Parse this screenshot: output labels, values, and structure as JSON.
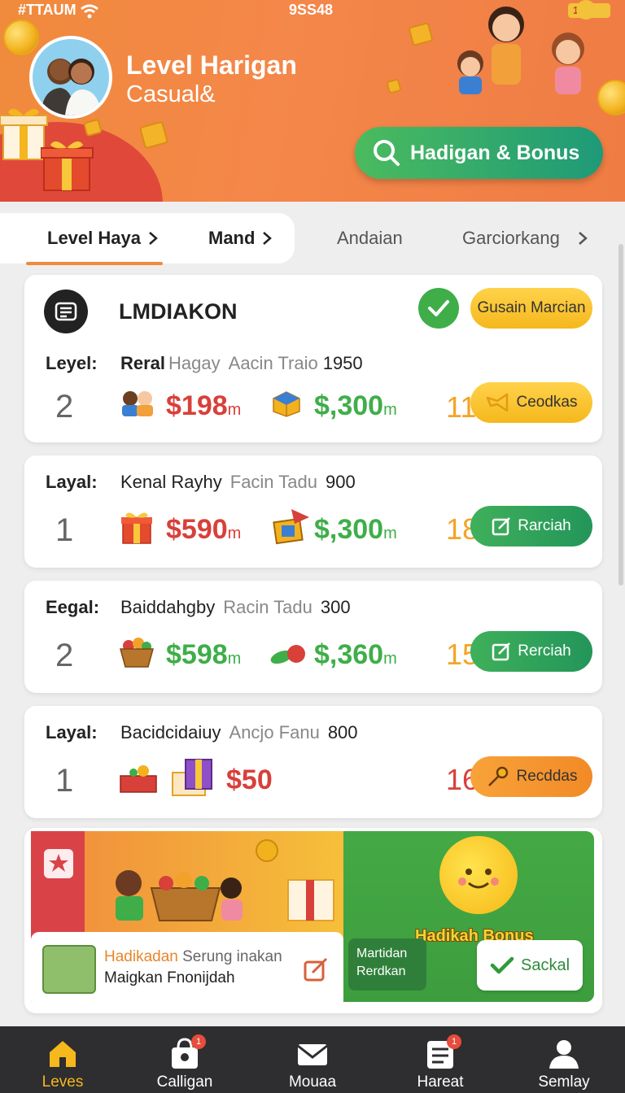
{
  "status_bar": {
    "left": "#TTAUM",
    "time": "9SS48",
    "battery": "10"
  },
  "header": {
    "title": "Level Harigan",
    "subtitle": "Casual&",
    "search_button": "Hadigan & Bonus"
  },
  "tabs": [
    {
      "label": "Level Haya",
      "active": true
    },
    {
      "label": "Mand",
      "active": false
    },
    {
      "label": "Andaian",
      "active": false
    },
    {
      "label": "Garciorkang",
      "active": false
    }
  ],
  "featured": {
    "title": "LMDIAKON",
    "badge_button": "Gusain Marcian",
    "row_label": "Leyel:",
    "row_name": "Reral",
    "row_sub1": "Hagay",
    "row_sub2": "Aacin Traio",
    "row_value": "1950",
    "level": "2",
    "amount1": "$198",
    "amount2": "$,300",
    "unit": "m",
    "count": "11",
    "action": "Ceodkas"
  },
  "rows": [
    {
      "label": "Layal:",
      "name": "Kenal Rayhy",
      "sub": "Facin Tadu",
      "value": "900",
      "level": "1",
      "amount1": "$590",
      "amount1_color": "red",
      "amount2": "$,300",
      "unit": "m",
      "count": "18",
      "count_color": "#f3a425",
      "action": "Rarciah",
      "action_style": "green"
    },
    {
      "label": "Eegal:",
      "name": "Baiddahgby",
      "sub": "Racin Tadu",
      "value": "300",
      "level": "2",
      "amount1": "$598",
      "amount1_color": "green",
      "amount2": "$,360",
      "unit": "m",
      "count": "15",
      "count_color": "#f3a425",
      "action": "Rerciah",
      "action_style": "green"
    },
    {
      "label": "Layal:",
      "name": "Bacidcidaiuy",
      "sub": "Ancjo Fanu",
      "value": "800",
      "level": "1",
      "amount1": "$50",
      "amount1_color": "red",
      "amount2": "",
      "unit": "",
      "count": "16",
      "count_color": "#d8403a",
      "action": "Recddas",
      "action_style": "orange"
    }
  ],
  "promo": {
    "bonus_title": "Hadikah Bonus",
    "line1_highlight": "Hadikadan",
    "line1_rest": "Serung inakan",
    "line2": "Maigkan Fnonijdah",
    "mini_line1": "Martidan",
    "mini_line2": "Rerdkan",
    "save_button": "Sackal"
  },
  "nav": [
    {
      "label": "Leves",
      "icon": "home-icon",
      "active": true,
      "badge": ""
    },
    {
      "label": "Calligan",
      "icon": "gift-bag-icon",
      "active": false,
      "badge": "1"
    },
    {
      "label": "Mouaa",
      "icon": "mail-icon",
      "active": false,
      "badge": ""
    },
    {
      "label": "Hareat",
      "icon": "list-icon",
      "active": false,
      "badge": "1"
    },
    {
      "label": "Semlay",
      "icon": "person-icon",
      "active": false,
      "badge": ""
    }
  ],
  "colors": {
    "accent": "#f08a3c",
    "green": "#3fae49",
    "red": "#d8403a",
    "yellow": "#f5b81d"
  }
}
